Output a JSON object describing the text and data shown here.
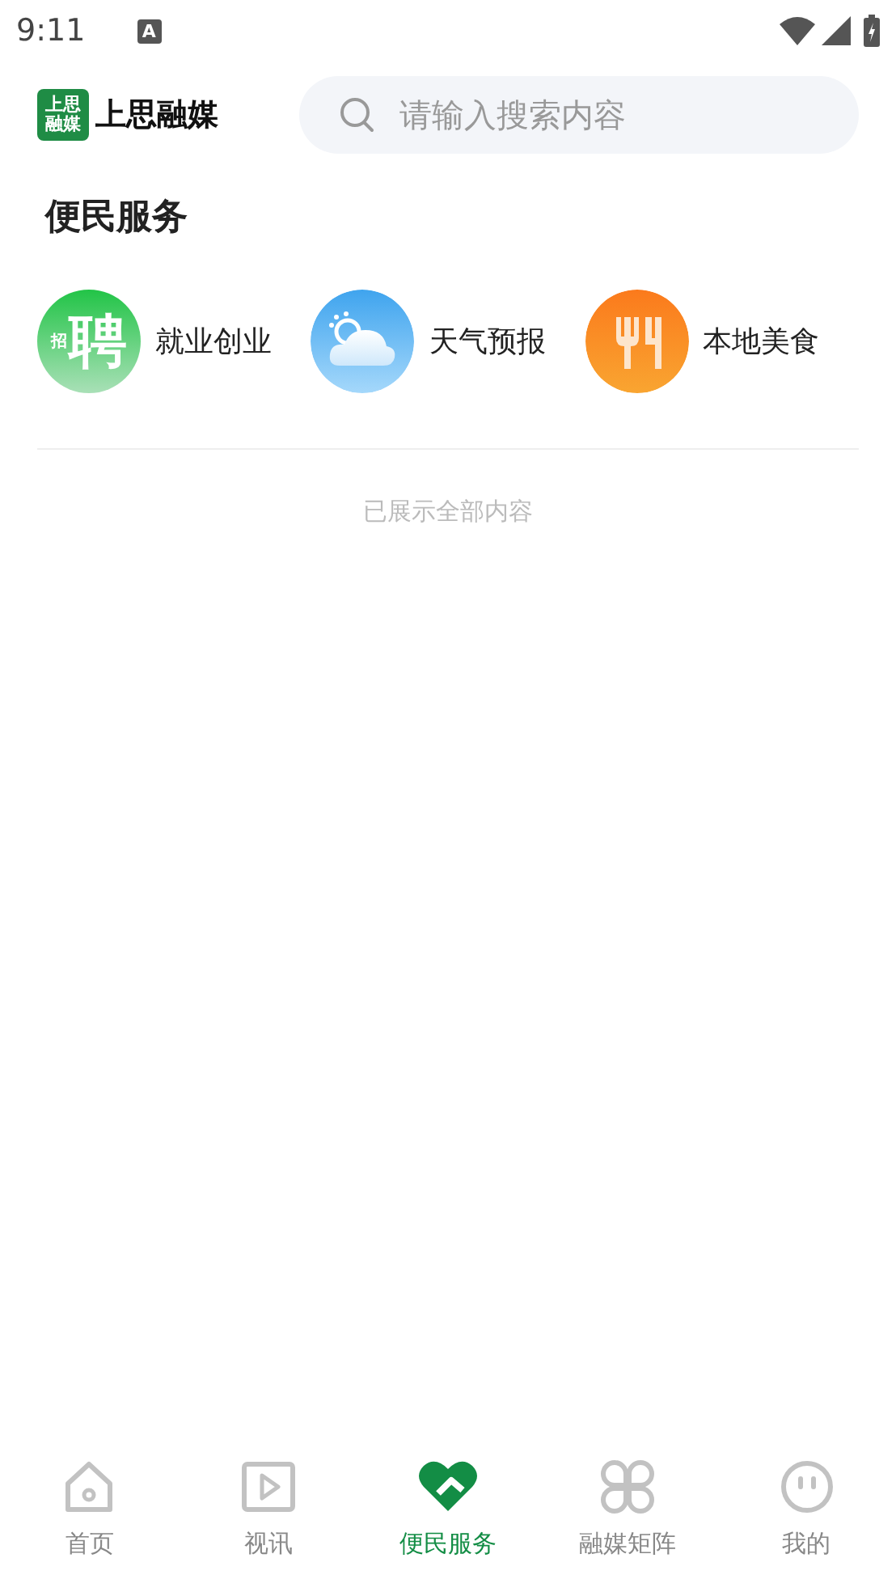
{
  "status_bar": {
    "time": "9:11",
    "notification": "A"
  },
  "header": {
    "logo_text": "上思融媒",
    "logo_mark": [
      "上思",
      "融媒"
    ],
    "search": {
      "placeholder": "请输入搜索内容"
    }
  },
  "section": {
    "title": "便民服务"
  },
  "services": [
    {
      "kind": "recruit",
      "label": "就业创业",
      "icon_text": "聘",
      "icon_small": "招"
    },
    {
      "kind": "weather",
      "label": "天气预报"
    },
    {
      "kind": "food",
      "label": "本地美食"
    }
  ],
  "end_note": "已展示全部内容",
  "tabs": [
    {
      "kind": "home",
      "label": "首页",
      "selected": false
    },
    {
      "kind": "video",
      "label": "视讯",
      "selected": false
    },
    {
      "kind": "service",
      "label": "便民服务",
      "selected": true
    },
    {
      "kind": "matrix",
      "label": "融媒矩阵",
      "selected": false
    },
    {
      "kind": "me",
      "label": "我的",
      "selected": false
    }
  ]
}
